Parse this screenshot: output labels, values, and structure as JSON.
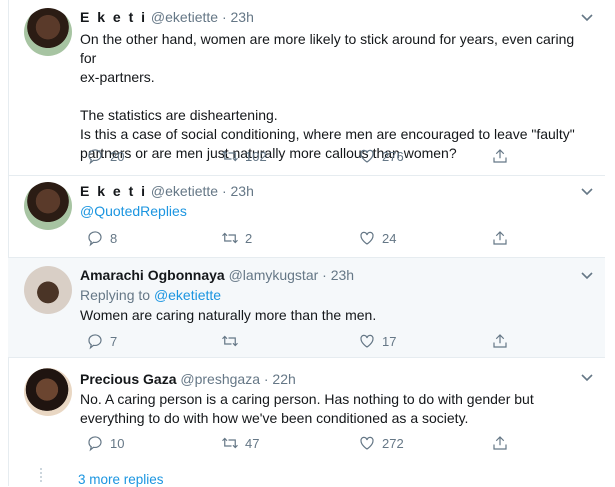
{
  "tweets": [
    {
      "name": "E k e t i",
      "handle": "@eketiette",
      "time": "· 23h",
      "text_lines": [
        "On the other hand, women are more likely to stick around for years, even caring for",
        "ex-partners.",
        "",
        "The statistics are disheartening.",
        "Is this a case of social conditioning, where men are encouraged to leave \"faulty\"",
        "partners or are men just naturally more callous than women?"
      ],
      "replies": "20",
      "retweets": "102",
      "likes": "276"
    },
    {
      "name": "E k e t i",
      "handle": "@eketiette",
      "time": "· 23h",
      "text": "@QuotedReplies",
      "replies": "8",
      "retweets": "2",
      "likes": "24"
    },
    {
      "name": "Amarachi Ogbonnaya",
      "handle": "@lamykugstar",
      "time": "· 23h",
      "replying_label": "Replying to",
      "replying_to": "@eketiette",
      "text": "Women are caring naturally more than the men.",
      "replies": "7",
      "retweets": "",
      "likes": "17"
    },
    {
      "name": "Precious Gaza",
      "handle": "@preshgaza",
      "time": "· 22h",
      "text_lines": [
        "No. A caring person is a caring person. Has nothing to do with gender but",
        "everything to do with how we've been conditioned as a society."
      ],
      "replies": "10",
      "retweets": "47",
      "likes": "272"
    }
  ],
  "more_replies": "3 more replies",
  "colors": {
    "link": "#1b95e0",
    "muted": "#657786",
    "border": "#e6ecf0",
    "highlight_bg": "#f5f8fa"
  },
  "icons": [
    "reply-icon",
    "retweet-icon",
    "like-icon",
    "share-icon",
    "chevron-down-icon"
  ]
}
